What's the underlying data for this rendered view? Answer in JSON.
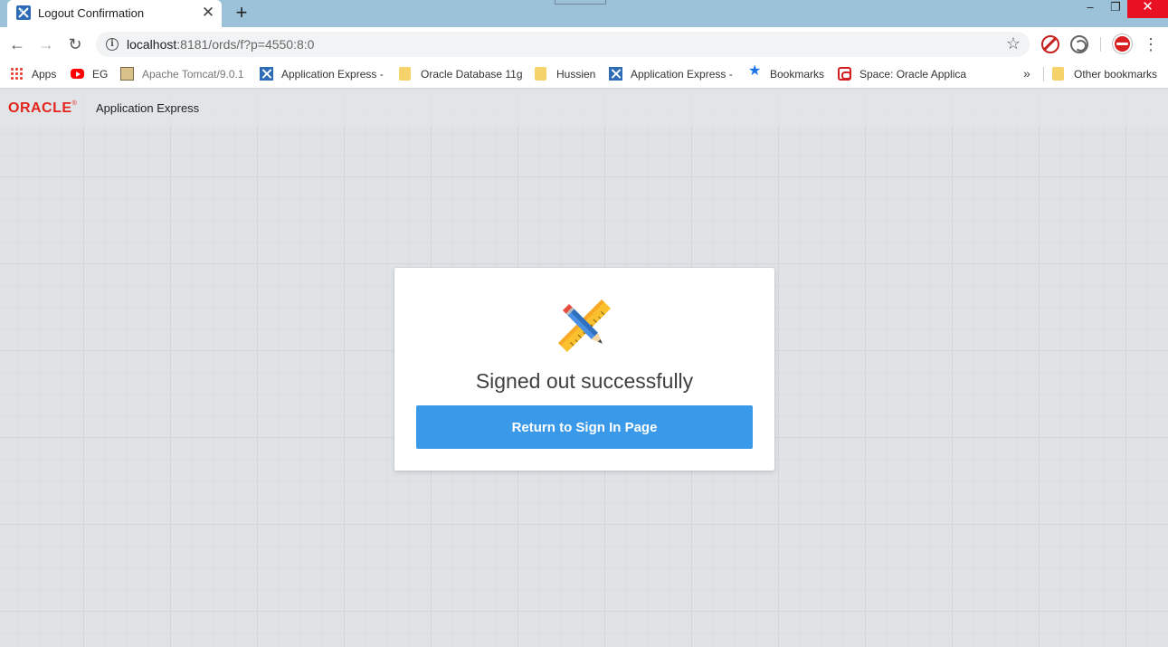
{
  "browser": {
    "tab": {
      "title": "Logout Confirmation",
      "close": "✕",
      "favicon": "apex-icon"
    },
    "new_tab": "+",
    "window_controls": {
      "minimize": "‒",
      "maximize": "❐",
      "close": "✕"
    },
    "url": {
      "host": "localhost",
      "rest": ":8181/ords/f?p=4550:8:0"
    },
    "icons": {
      "back": "←",
      "forward": "→",
      "reload": "↻",
      "star": "☆",
      "menu": "⋮"
    },
    "bookmarks": [
      {
        "label": "Apps",
        "icon": "apps-grid-icon"
      },
      {
        "label": "EG",
        "icon": "youtube-icon"
      },
      {
        "label": "Apache Tomcat/9.0.1",
        "icon": "tomcat-icon"
      },
      {
        "label": "Application Express -",
        "icon": "apex-icon"
      },
      {
        "label": "Oracle Database 11g",
        "icon": "folder-icon"
      },
      {
        "label": "Hussien",
        "icon": "folder-icon"
      },
      {
        "label": "Application Express -",
        "icon": "apex-icon"
      },
      {
        "label": "Bookmarks",
        "icon": "star-icon"
      },
      {
        "label": "Space: Oracle Applica",
        "icon": "oracle-icon"
      }
    ],
    "bookmarks_more": "»",
    "other_bookmarks": "Other bookmarks"
  },
  "app": {
    "logo_text": "ORACLE",
    "logo_mark": "®",
    "name": "Application Express"
  },
  "card": {
    "message": "Signed out successfully",
    "button_label": "Return to Sign In Page"
  },
  "colors": {
    "accent": "#3a9ae9",
    "oracle_red": "#e3251e",
    "titlebar": "#9bc2d8"
  }
}
